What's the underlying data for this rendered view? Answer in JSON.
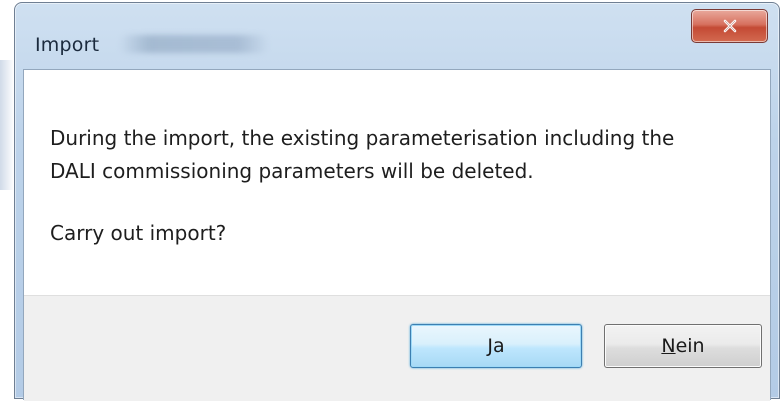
{
  "window": {
    "title": "Import"
  },
  "titlebar": {
    "close_icon": "close-icon"
  },
  "message": {
    "line1": "During the import, the existing parameterisation including the",
    "line2": "DALI commissioning parameters will be deleted.",
    "question": "Carry out import?"
  },
  "buttons": {
    "yes_label": "Ja",
    "no_mnemonic": "N",
    "no_rest": "ein"
  },
  "colors": {
    "title_text": "#1b2a3d",
    "close_button": "#c44a35",
    "default_button_border": "#3c7fb1"
  }
}
